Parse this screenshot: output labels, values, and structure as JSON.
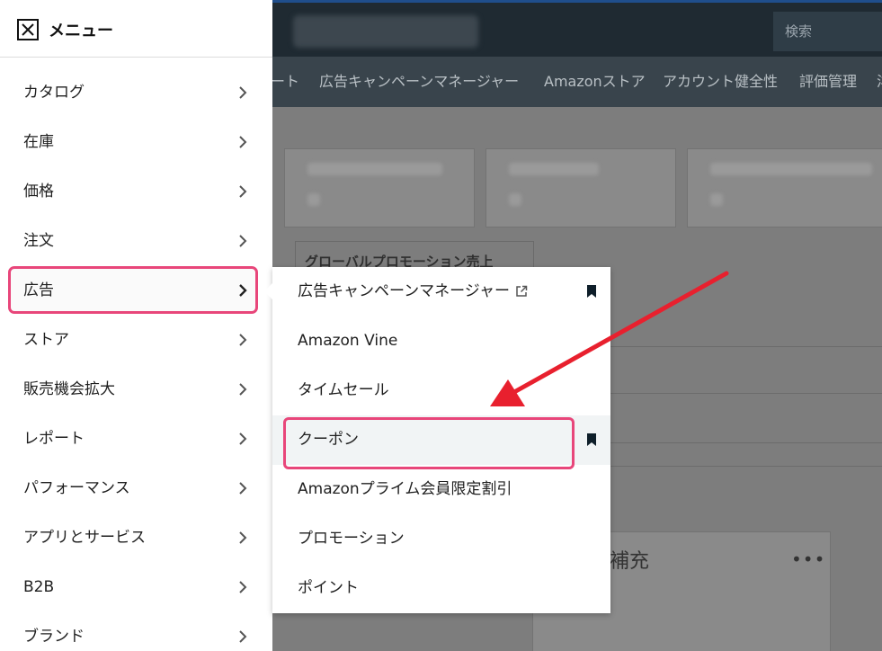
{
  "header": {
    "search_placeholder": "検索"
  },
  "top_nav": {
    "items": [
      {
        "label": "ート"
      },
      {
        "label": "広告キャンペーンマネージャー"
      },
      {
        "label": "Amazonストア"
      },
      {
        "label": "アカウント健全性"
      },
      {
        "label": "評価管理"
      },
      {
        "label": "洋"
      }
    ]
  },
  "background": {
    "tab_label": "グローバルプロモーション売上",
    "panel_title": "補充",
    "panel_more": "•••"
  },
  "menu": {
    "title": "メニュー",
    "items": [
      {
        "label": "カタログ"
      },
      {
        "label": "在庫"
      },
      {
        "label": "価格"
      },
      {
        "label": "注文"
      },
      {
        "label": "広告"
      },
      {
        "label": "ストア"
      },
      {
        "label": "販売機会拡大"
      },
      {
        "label": "レポート"
      },
      {
        "label": "パフォーマンス"
      },
      {
        "label": "アプリとサービス"
      },
      {
        "label": "B2B"
      },
      {
        "label": "ブランド"
      }
    ],
    "active_index": 4
  },
  "submenu": {
    "items": [
      {
        "label": "広告キャンペーンマネージャー",
        "external": true,
        "bookmarked": true
      },
      {
        "label": "Amazon Vine",
        "external": false,
        "bookmarked": false
      },
      {
        "label": "タイムセール",
        "external": false,
        "bookmarked": false
      },
      {
        "label": "クーポン",
        "external": false,
        "bookmarked": true
      },
      {
        "label": "Amazonプライム会員限定割引",
        "external": false,
        "bookmarked": false
      },
      {
        "label": "プロモーション",
        "external": false,
        "bookmarked": false
      },
      {
        "label": "ポイント",
        "external": false,
        "bookmarked": false
      }
    ],
    "highlighted_index": 3
  },
  "colors": {
    "highlight": "#e8467a",
    "arrow": "#e8202e",
    "header_bg": "#1f2a32"
  }
}
